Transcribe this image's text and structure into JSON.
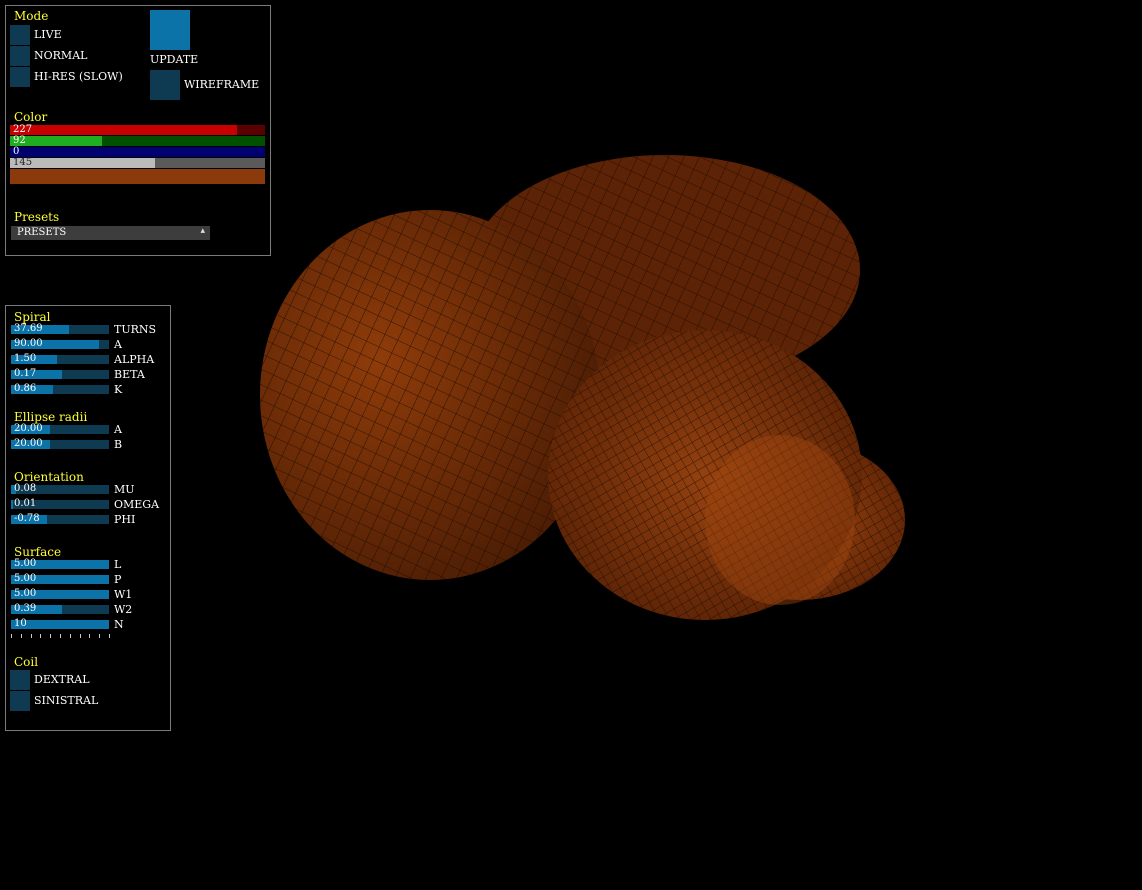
{
  "mode_panel": {
    "title": "Mode",
    "options": [
      "LIVE",
      "NORMAL",
      "HI-RES (SLOW)"
    ],
    "update_label": "UPDATE",
    "wireframe_label": "WIREFRAME"
  },
  "color_panel": {
    "title": "Color",
    "red": 227,
    "green": 92,
    "blue": 0,
    "alpha": 145,
    "preview_color": "#8b3a0b"
  },
  "presets_panel": {
    "title": "Presets",
    "selected": "PRESETS"
  },
  "spiral": {
    "title": "Spiral",
    "sliders": [
      {
        "value": "37.69",
        "label": "TURNS",
        "fill": 0.59
      },
      {
        "value": "90.00",
        "label": "A",
        "fill": 0.9
      },
      {
        "value": "1.50",
        "label": "ALPHA",
        "fill": 0.47
      },
      {
        "value": "0.17",
        "label": "BETA",
        "fill": 0.52
      },
      {
        "value": "0.86",
        "label": "K",
        "fill": 0.43
      }
    ]
  },
  "ellipse": {
    "title": "Ellipse radii",
    "sliders": [
      {
        "value": "20.00",
        "label": "A",
        "fill": 0.4
      },
      {
        "value": "20.00",
        "label": "B",
        "fill": 0.4
      }
    ]
  },
  "orientation": {
    "title": "Orientation",
    "sliders": [
      {
        "value": "0.08",
        "label": "MU",
        "fill": 0.05
      },
      {
        "value": "0.01",
        "label": "OMEGA",
        "fill": 0.02
      },
      {
        "value": "-0.78",
        "label": "PHI",
        "fill": 0.37
      }
    ]
  },
  "surface": {
    "title": "Surface",
    "sliders": [
      {
        "value": "5.00",
        "label": "L",
        "fill": 1.0
      },
      {
        "value": "5.00",
        "label": "P",
        "fill": 1.0
      },
      {
        "value": "5.00",
        "label": "W1",
        "fill": 1.0
      },
      {
        "value": "0.39",
        "label": "W2",
        "fill": 0.52
      },
      {
        "value": "10",
        "label": "N",
        "fill": 1.0
      }
    ]
  },
  "coil": {
    "title": "Coil",
    "options": [
      "DEXTRAL",
      "SINISTRAL"
    ]
  },
  "colors": {
    "toggle_off": "#0e3a52",
    "toggle_on": "#0b73a8",
    "title": "#ffff33",
    "shell": "#8b3a0b"
  }
}
